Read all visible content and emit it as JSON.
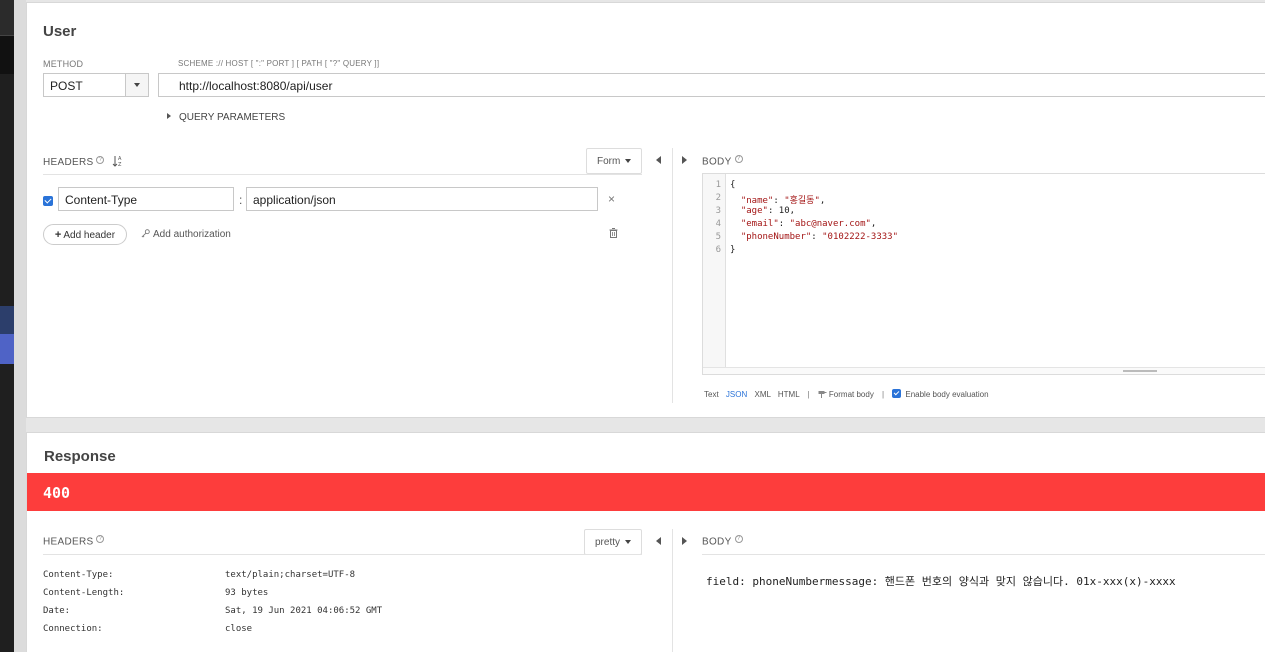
{
  "request": {
    "title": "User",
    "method_label": "METHOD",
    "method_value": "POST",
    "url_label": "SCHEME :// HOST [ \":\" PORT ] [ PATH [ \"?\" QUERY ]]",
    "url_value": "http://localhost:8080/api/user",
    "query_parameters_label": "QUERY PARAMETERS",
    "headers_label": "HEADERS",
    "headers_mode": "Form",
    "headers": [
      {
        "enabled": true,
        "name": "Content-Type",
        "value": "application/json"
      }
    ],
    "add_header_label": "Add header",
    "add_authorization_label": "Add authorization",
    "body_label": "BODY",
    "body_lines": [
      {
        "n": "1",
        "text": "{"
      },
      {
        "n": "2",
        "key": "\"name\"",
        "sep": ": ",
        "val": "\"홍길동\"",
        "tail": ","
      },
      {
        "n": "3",
        "key": "\"age\"",
        "sep": ": ",
        "val": "10",
        "tail": ","
      },
      {
        "n": "4",
        "key": "\"email\"",
        "sep": ": ",
        "val": "\"abc@naver.com\"",
        "tail": ","
      },
      {
        "n": "5",
        "key": "\"phoneNumber\"",
        "sep": ": ",
        "val": "\"0102222-3333\"",
        "tail": ""
      },
      {
        "n": "6",
        "text": "}"
      }
    ],
    "body_formats": [
      "Text",
      "JSON",
      "XML",
      "HTML"
    ],
    "body_format_active": "JSON",
    "format_body_label": "Format body",
    "enable_body_evaluation_label": "Enable body evaluation"
  },
  "response": {
    "title": "Response",
    "status_code": "400",
    "status_color": "#fd3d3c",
    "headers_label": "HEADERS",
    "headers_mode": "pretty",
    "headers": [
      {
        "name": "Content-Type:",
        "value": "text/plain;charset=UTF-8"
      },
      {
        "name": "Content-Length:",
        "value": "93 bytes"
      },
      {
        "name": "Date:",
        "value": "Sat, 19 Jun 2021 04:06:52 GMT"
      },
      {
        "name": "Connection:",
        "value": "close"
      }
    ],
    "body_label": "BODY",
    "body_text": "field: phoneNumbermessage: 핸드폰 번호의 양식과 맞지 않습니다. 01x-xxx(x)-xxxx"
  },
  "icons": {
    "help": "help-circle-icon",
    "sort": "sort-az-icon",
    "key": "key-icon",
    "trash": "trash-icon",
    "close": "close-icon"
  }
}
